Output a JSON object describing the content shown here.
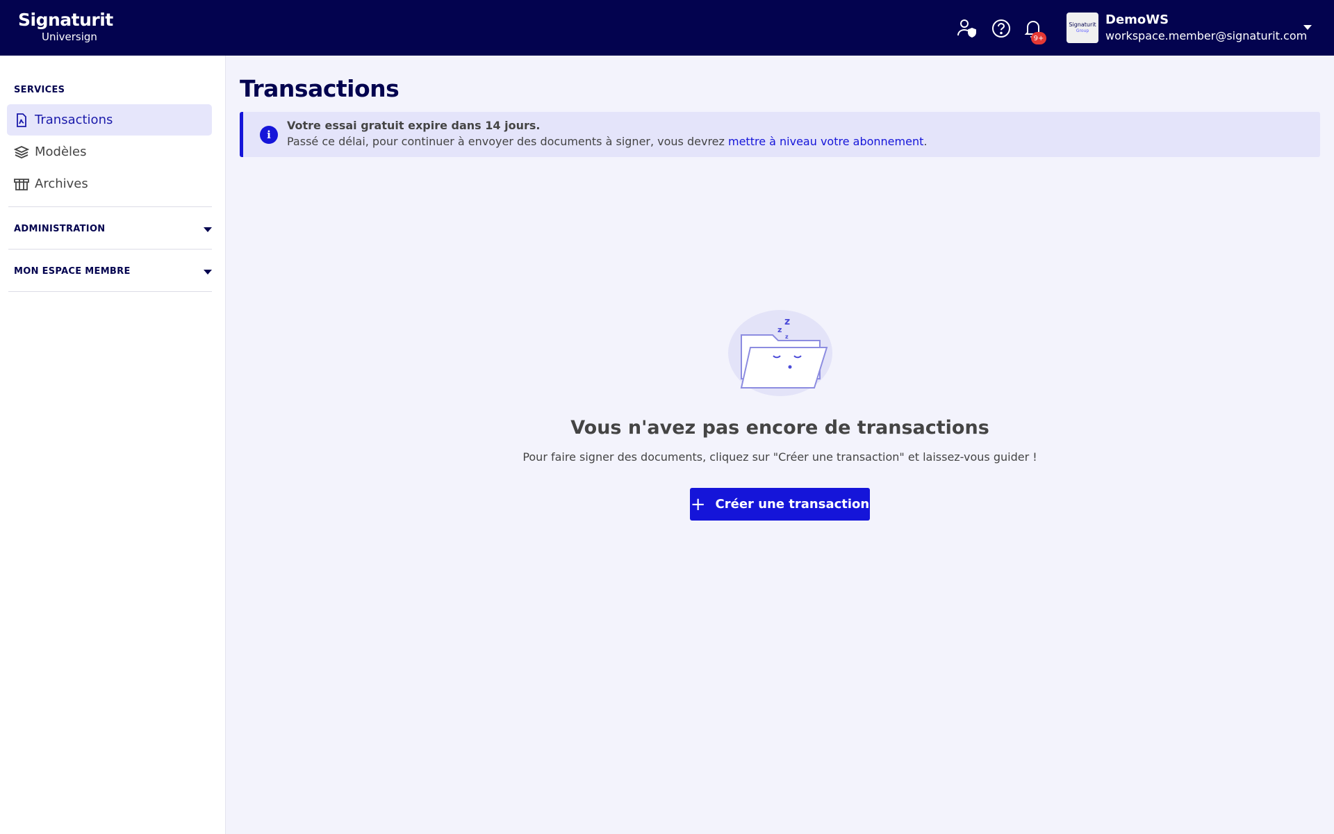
{
  "brand": {
    "name": "Signaturit",
    "sub": "Universign"
  },
  "header": {
    "notification_badge": "9+",
    "workspace": {
      "logo_line1": "Signaturit",
      "logo_line2": "Group",
      "name": "DemoWS",
      "email": "workspace.member@signaturit.com"
    }
  },
  "sidebar": {
    "services_title": "SERVICES",
    "items": [
      {
        "label": "Transactions",
        "icon": "document-icon",
        "active": true
      },
      {
        "label": "Modèles",
        "icon": "layers-icon",
        "active": false
      },
      {
        "label": "Archives",
        "icon": "archive-box-icon",
        "active": false
      }
    ],
    "administration_label": "ADMINISTRATION",
    "member_space_label": "MON ESPACE MEMBRE"
  },
  "main": {
    "title": "Transactions",
    "alert": {
      "title": "Votre essai gratuit expire dans 14 jours.",
      "body_prefix": "Passé ce délai, pour continuer à envoyer des documents à signer, vous devrez ",
      "link": "mettre à niveau votre abonnement",
      "body_suffix": "."
    },
    "empty": {
      "title": "Vous n'avez pas encore de transactions",
      "subtitle": "Pour faire signer des documents, cliquez sur \"Créer une transaction\" et laissez-vous guider !",
      "button": "Créer une transaction"
    }
  },
  "colors": {
    "header_bg": "#03034f",
    "accent": "#1515d9",
    "active_nav_bg": "#e6e6fb",
    "badge": "#e53935"
  }
}
